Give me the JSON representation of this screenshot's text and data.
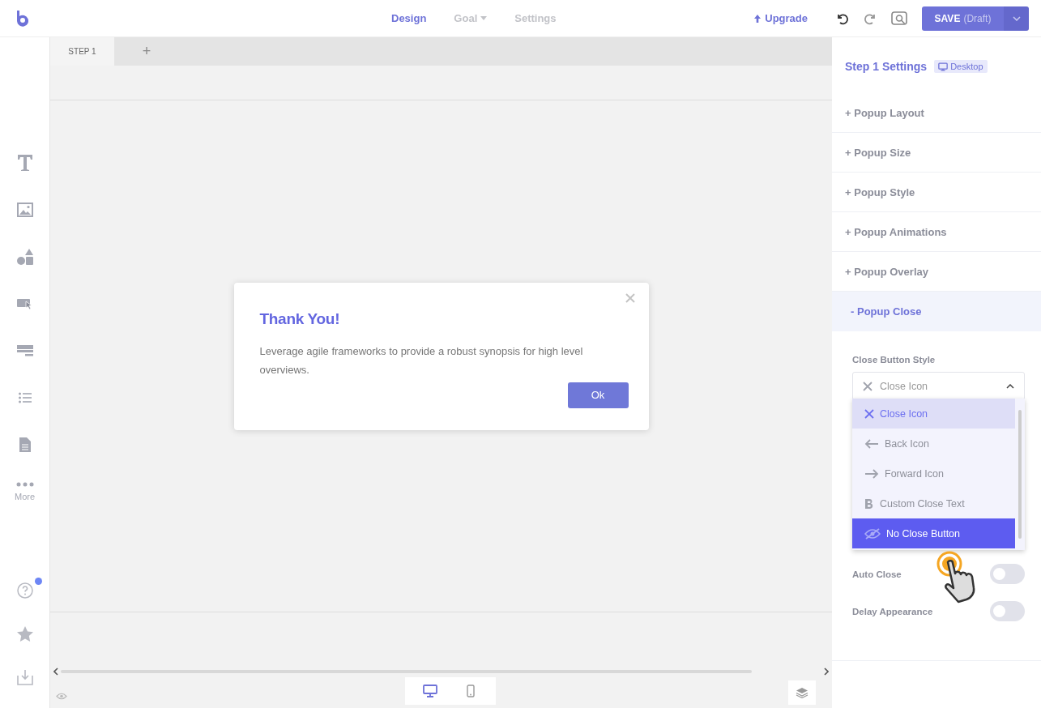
{
  "nav": {
    "tabs": [
      {
        "label": "Design",
        "selected": true,
        "dropdown": false
      },
      {
        "label": "Goal",
        "selected": false,
        "dropdown": true
      },
      {
        "label": "Settings",
        "selected": false,
        "dropdown": false
      }
    ],
    "upgrade": "Upgrade",
    "save": {
      "label": "SAVE",
      "note": "(Draft)"
    }
  },
  "tools": [
    {
      "kind": "text"
    },
    {
      "kind": "image"
    },
    {
      "kind": "shapes"
    },
    {
      "kind": "button"
    },
    {
      "kind": "form"
    },
    {
      "kind": "list"
    },
    {
      "kind": "document"
    },
    {
      "kind": "more",
      "label": "More"
    }
  ],
  "bottom_tools": [
    {
      "kind": "help",
      "badge": true
    },
    {
      "kind": "star"
    },
    {
      "kind": "download"
    }
  ],
  "steps": [
    {
      "label": "STEP 1",
      "selected": true
    }
  ],
  "add_step": "+",
  "popup": {
    "title": "Thank You!",
    "body": "Leverage agile frameworks to provide a robust synopsis for high level overviews.",
    "button": "Ok"
  },
  "devices": [
    {
      "kind": "desktop",
      "selected": true
    },
    {
      "kind": "mobile",
      "selected": false
    }
  ],
  "panel": {
    "title": "Step 1 Settings",
    "badge": "Desktop",
    "sections": [
      {
        "sign": "+",
        "label": "Popup Layout",
        "expanded": false
      },
      {
        "sign": "+",
        "label": "Popup Size",
        "expanded": false
      },
      {
        "sign": "+",
        "label": "Popup Style",
        "expanded": false
      },
      {
        "sign": "+",
        "label": "Popup Animations",
        "expanded": false
      },
      {
        "sign": "+",
        "label": "Popup Overlay",
        "expanded": false
      },
      {
        "sign": "-",
        "label": "Popup Close",
        "expanded": true
      }
    ],
    "close_style": {
      "label": "Close Button Style",
      "value": "Close Icon",
      "kind": "close",
      "open": true,
      "options": [
        {
          "kind": "close",
          "label": "Close Icon",
          "selected": true,
          "hovered": false
        },
        {
          "kind": "back",
          "label": "Back Icon",
          "selected": false,
          "hovered": false
        },
        {
          "kind": "forward",
          "label": "Forward Icon",
          "selected": false,
          "hovered": false
        },
        {
          "kind": "text",
          "label": "Custom Close Text",
          "selected": false,
          "hovered": false
        },
        {
          "kind": "hidden",
          "label": "No Close Button",
          "selected": false,
          "hovered": true
        }
      ]
    },
    "toggles": [
      {
        "label": "Auto Close",
        "on": false
      },
      {
        "label": "Delay Appearance",
        "on": false
      }
    ]
  }
}
